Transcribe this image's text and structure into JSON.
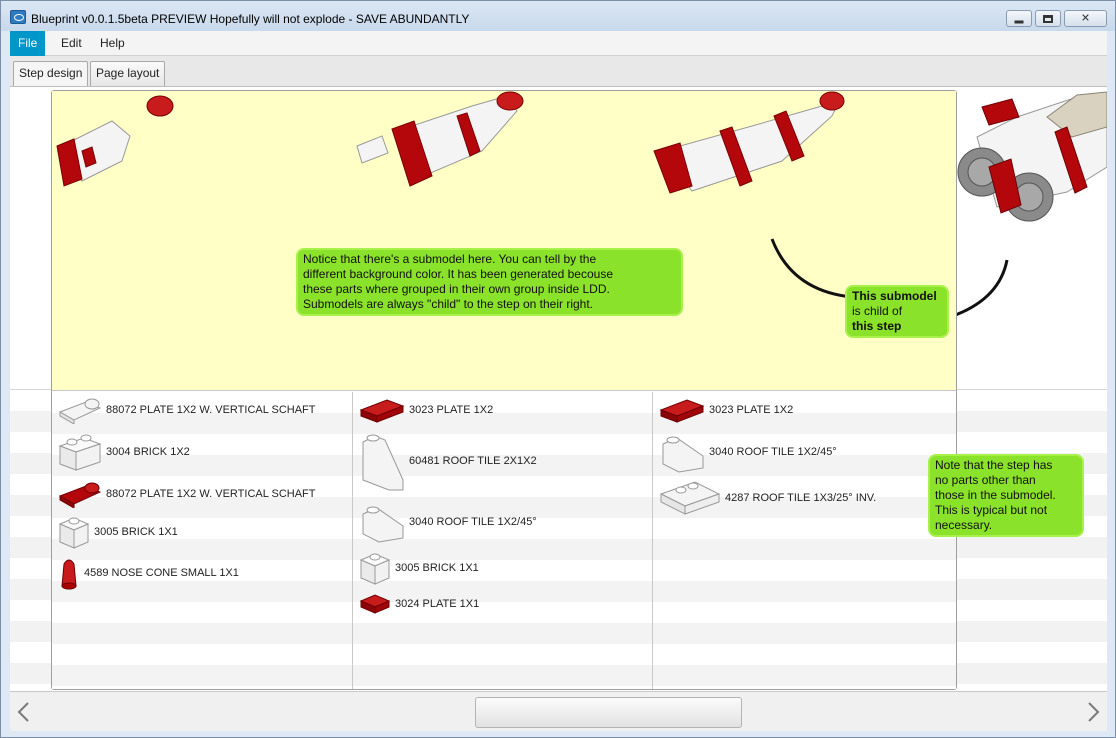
{
  "window": {
    "title": "Blueprint v0.0.1.5beta PREVIEW Hopefully will not explode - SAVE ABUNDANTLY"
  },
  "menu": {
    "items": [
      {
        "label": "File",
        "active": true
      },
      {
        "label": "Edit",
        "active": false
      },
      {
        "label": "Help",
        "active": false
      }
    ]
  },
  "tabs": [
    {
      "label": "Step design",
      "selected": true
    },
    {
      "label": "Page layout",
      "selected": false
    }
  ],
  "callouts": {
    "submodel_note": {
      "lines": [
        "Notice that there's a submodel here. You can tell by the",
        "different background color. It has been generated becouse",
        "these parts where grouped in their own group inside LDD.",
        "Submodels are always \"child\" to the step on their right."
      ]
    },
    "child_note": {
      "line1": "This submodel",
      "line2": "is child of",
      "line3": "this step"
    },
    "step_note": {
      "lines": [
        "Note that the step has",
        "no parts other than",
        "those in the submodel.",
        "This is typical but not",
        "necessary."
      ]
    }
  },
  "parts": {
    "col1": [
      {
        "label": "88072 PLATE 1X2 W. VERTICAL SCHAFT",
        "color": "white",
        "icon": "plate-vertical-shaft-icon"
      },
      {
        "label": "3004 BRICK 1X2",
        "color": "white",
        "icon": "brick-1x2-icon"
      },
      {
        "label": "88072 PLATE 1X2 W. VERTICAL SCHAFT",
        "color": "red",
        "icon": "plate-vertical-shaft-icon"
      },
      {
        "label": "3005 BRICK 1X1",
        "color": "white",
        "icon": "brick-1x1-icon"
      },
      {
        "label": "4589 NOSE CONE SMALL 1X1",
        "color": "red",
        "icon": "nose-cone-icon"
      }
    ],
    "col2": [
      {
        "label": "3023 PLATE 1X2",
        "color": "red",
        "icon": "plate-1x2-icon"
      },
      {
        "label": "60481 ROOF TILE 2X1X2",
        "color": "white",
        "icon": "roof-tile-tall-icon"
      },
      {
        "label": "3040 ROOF TILE 1X2/45°",
        "color": "white",
        "icon": "roof-tile-45-icon"
      },
      {
        "label": "3005 BRICK 1X1",
        "color": "white",
        "icon": "brick-1x1-icon"
      },
      {
        "label": "3024 PLATE 1X1",
        "color": "red",
        "icon": "plate-1x1-icon"
      }
    ],
    "col3": [
      {
        "label": "3023 PLATE 1X2",
        "color": "red",
        "icon": "plate-1x2-icon"
      },
      {
        "label": "3040 ROOF TILE 1X2/45°",
        "color": "white",
        "icon": "roof-tile-45-icon"
      },
      {
        "label": "4287 ROOF TILE 1X3/25° INV.",
        "color": "white",
        "icon": "roof-tile-inverted-icon"
      }
    ]
  },
  "colors": {
    "accent": "#0096c9",
    "submodel_bg": "#ffffc6",
    "callout_bg": "#8be22a",
    "brick_red": "#b3070c",
    "brick_white": "#f4f4f4"
  },
  "nav": {
    "prev_icon": "chevron-left-icon",
    "next_icon": "chevron-right-icon"
  }
}
